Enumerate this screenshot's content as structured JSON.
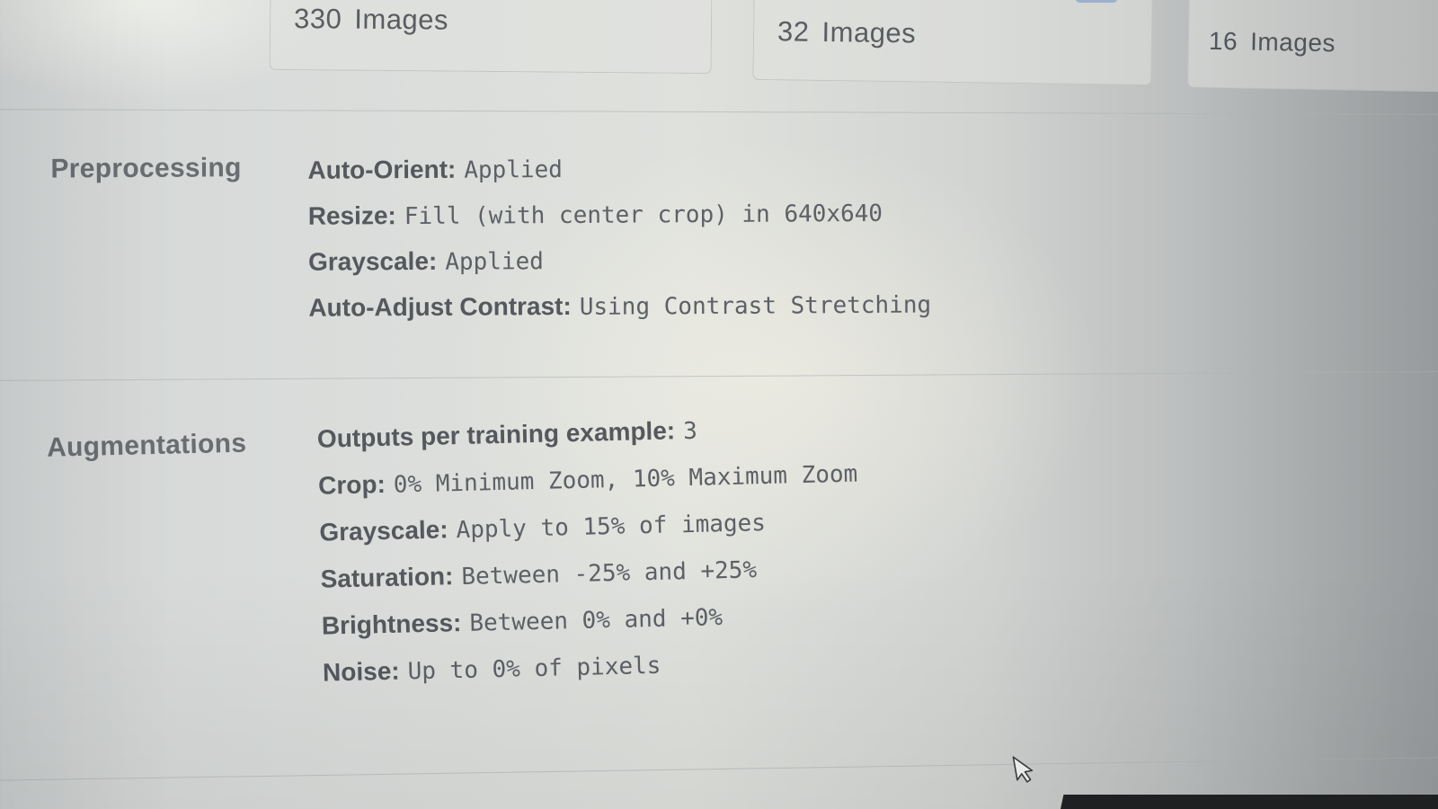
{
  "splits": [
    {
      "count": "330",
      "unit": "Images"
    },
    {
      "count": "32",
      "unit": "Images"
    },
    {
      "count": "16",
      "unit": "Images"
    }
  ],
  "preprocessing": {
    "heading": "Preprocessing",
    "steps": [
      {
        "label": "Auto-Orient:",
        "value": "Applied"
      },
      {
        "label": "Resize:",
        "value": "Fill (with center crop) in 640x640"
      },
      {
        "label": "Grayscale:",
        "value": "Applied"
      },
      {
        "label": "Auto-Adjust Contrast:",
        "value": "Using Contrast Stretching"
      }
    ]
  },
  "augmentations": {
    "heading": "Augmentations",
    "steps": [
      {
        "label": "Outputs per training example:",
        "value": "3"
      },
      {
        "label": "Crop:",
        "value": "0% Minimum Zoom, 10% Maximum Zoom"
      },
      {
        "label": "Grayscale:",
        "value": "Apply to 15% of images"
      },
      {
        "label": "Saturation:",
        "value": "Between -25% and +25%"
      },
      {
        "label": "Brightness:",
        "value": "Between 0% and +0%"
      },
      {
        "label": "Noise:",
        "value": "Up to 0% of pixels"
      }
    ]
  },
  "colors": {
    "accent": "#4a73b8",
    "text": "#55585d",
    "heading": "#6a6d71"
  },
  "icons": {
    "cursor": "mouse-pointer-icon"
  }
}
